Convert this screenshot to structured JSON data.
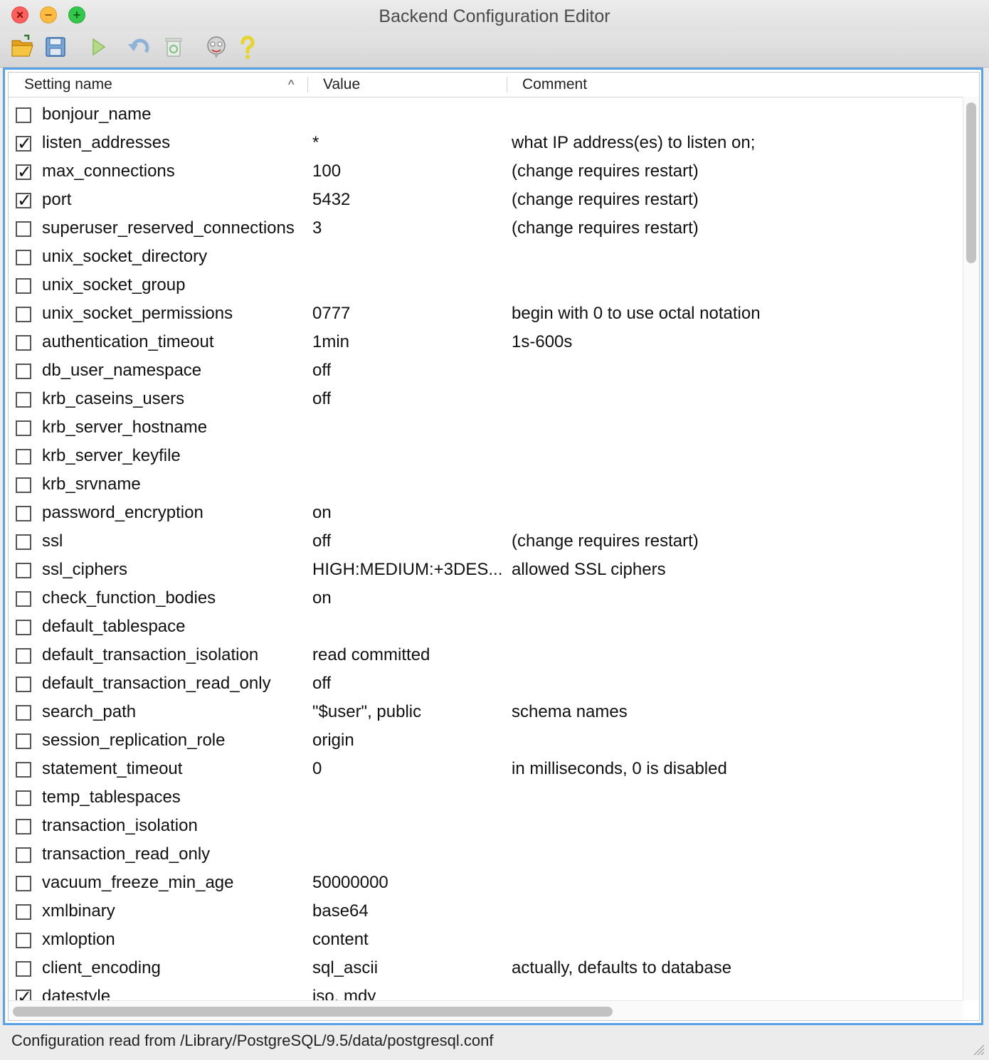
{
  "window": {
    "title": "Backend Configuration Editor"
  },
  "toolbar": {
    "buttons": [
      {
        "icon": "open-folder-icon"
      },
      {
        "icon": "save-icon"
      },
      {
        "icon": "run-icon"
      },
      {
        "icon": "undo-icon"
      },
      {
        "icon": "delete-icon"
      },
      {
        "icon": "hint-icon"
      },
      {
        "icon": "help-icon"
      }
    ]
  },
  "table": {
    "columns": [
      "Setting name",
      "Value",
      "Comment"
    ],
    "sort_column": "Setting name",
    "rows": [
      {
        "checked": false,
        "name": "bonjour_name",
        "value": "",
        "comment": ""
      },
      {
        "checked": true,
        "name": "listen_addresses",
        "value": "*",
        "comment": "what IP address(es) to listen on;"
      },
      {
        "checked": true,
        "name": "max_connections",
        "value": "100",
        "comment": "(change requires restart)"
      },
      {
        "checked": true,
        "name": "port",
        "value": "5432",
        "comment": "(change requires restart)"
      },
      {
        "checked": false,
        "name": "superuser_reserved_connections",
        "value": "3",
        "comment": "(change requires restart)"
      },
      {
        "checked": false,
        "name": "unix_socket_directory",
        "value": "",
        "comment": ""
      },
      {
        "checked": false,
        "name": "unix_socket_group",
        "value": "",
        "comment": ""
      },
      {
        "checked": false,
        "name": "unix_socket_permissions",
        "value": "0777",
        "comment": "begin with 0 to use octal notation"
      },
      {
        "checked": false,
        "name": "authentication_timeout",
        "value": "1min",
        "comment": "1s-600s"
      },
      {
        "checked": false,
        "name": "db_user_namespace",
        "value": "off",
        "comment": ""
      },
      {
        "checked": false,
        "name": "krb_caseins_users",
        "value": "off",
        "comment": ""
      },
      {
        "checked": false,
        "name": "krb_server_hostname",
        "value": "",
        "comment": ""
      },
      {
        "checked": false,
        "name": "krb_server_keyfile",
        "value": "",
        "comment": ""
      },
      {
        "checked": false,
        "name": "krb_srvname",
        "value": "",
        "comment": ""
      },
      {
        "checked": false,
        "name": "password_encryption",
        "value": "on",
        "comment": ""
      },
      {
        "checked": false,
        "name": "ssl",
        "value": "off",
        "comment": "(change requires restart)"
      },
      {
        "checked": false,
        "name": "ssl_ciphers",
        "value": "HIGH:MEDIUM:+3DES...",
        "comment": "allowed SSL ciphers"
      },
      {
        "checked": false,
        "name": "check_function_bodies",
        "value": "on",
        "comment": ""
      },
      {
        "checked": false,
        "name": "default_tablespace",
        "value": "",
        "comment": ""
      },
      {
        "checked": false,
        "name": "default_transaction_isolation",
        "value": "read committed",
        "comment": ""
      },
      {
        "checked": false,
        "name": "default_transaction_read_only",
        "value": "off",
        "comment": ""
      },
      {
        "checked": false,
        "name": "search_path",
        "value": "\"$user\", public",
        "comment": "schema names"
      },
      {
        "checked": false,
        "name": "session_replication_role",
        "value": "origin",
        "comment": ""
      },
      {
        "checked": false,
        "name": "statement_timeout",
        "value": "0",
        "comment": "in milliseconds, 0 is disabled"
      },
      {
        "checked": false,
        "name": "temp_tablespaces",
        "value": "",
        "comment": ""
      },
      {
        "checked": false,
        "name": "transaction_isolation",
        "value": "",
        "comment": ""
      },
      {
        "checked": false,
        "name": "transaction_read_only",
        "value": "",
        "comment": ""
      },
      {
        "checked": false,
        "name": "vacuum_freeze_min_age",
        "value": "50000000",
        "comment": ""
      },
      {
        "checked": false,
        "name": "xmlbinary",
        "value": "base64",
        "comment": ""
      },
      {
        "checked": false,
        "name": "xmloption",
        "value": "content",
        "comment": ""
      },
      {
        "checked": false,
        "name": "client_encoding",
        "value": "sql_ascii",
        "comment": "actually, defaults to database"
      },
      {
        "checked": true,
        "name": "datestyle",
        "value": "iso, mdy",
        "comment": ""
      }
    ]
  },
  "status": {
    "text": "Configuration read from /Library/PostgreSQL/9.5/data/postgresql.conf"
  },
  "colors": {
    "focus_border": "#5aa2e8",
    "close": "#fc605c",
    "minimize": "#fdbc40",
    "maximize": "#34c84a"
  }
}
